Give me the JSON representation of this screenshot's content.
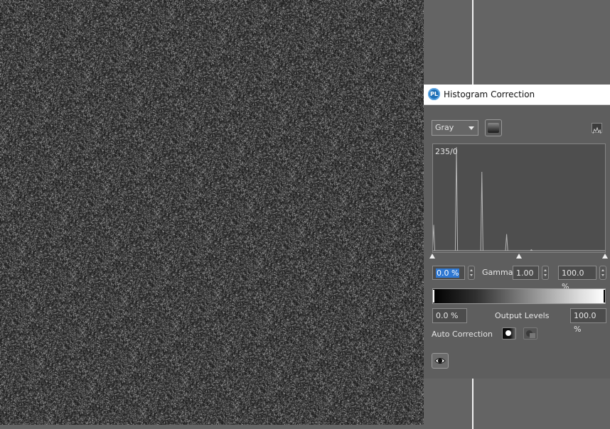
{
  "canvas": {
    "background": "#646464",
    "image_description_colors": {
      "dark": "#2a2a2a",
      "light": "#9a9a9a"
    }
  },
  "panel": {
    "title": "Histogram Correction",
    "app_icon": "pl-logo-icon",
    "channel": {
      "selected": "Gray"
    },
    "histogram": {
      "readout": "235/0",
      "peaks": [
        {
          "level": 0,
          "height": 0.25
        },
        {
          "level": 34,
          "height": 1.0
        },
        {
          "level": 72,
          "height": 0.76
        },
        {
          "level": 109,
          "height": 0.16
        },
        {
          "level": 146,
          "height": 0.01
        }
      ]
    },
    "input_levels": {
      "black": "0.0 %",
      "gamma_label": "Gamma:",
      "gamma": "1.00",
      "white": "100.0 %",
      "marker_positions": [
        0.0,
        0.5,
        1.0
      ]
    },
    "output_levels": {
      "black": "0.0 %",
      "label": "Output Levels",
      "white": "100.0 %"
    },
    "auto_correction": {
      "label": "Auto Correction",
      "buttons": [
        "auto-levels-icon",
        "auto-contrast-icon"
      ]
    },
    "preview_icon": "eye-icon",
    "colors": {
      "panel_bg": "#5e5e5e",
      "selection": "#2f78d2",
      "plot_bg": "#4e4e4e",
      "plot_line": "#b4b4b4"
    }
  }
}
